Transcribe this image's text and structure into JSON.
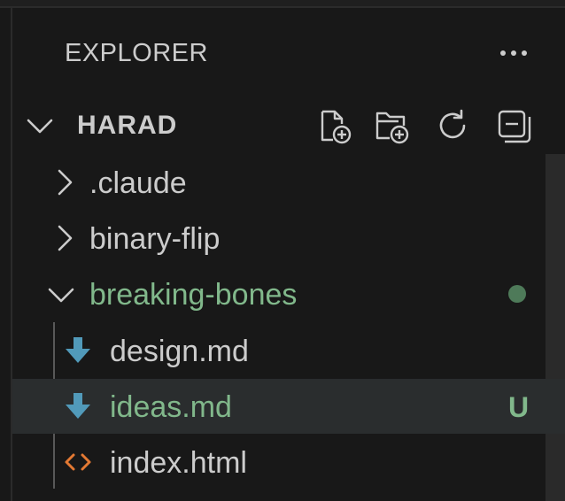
{
  "panel": {
    "title": "EXPLORER"
  },
  "workspace": {
    "name": "HARAD",
    "actions": [
      {
        "label": "New File...",
        "icon": "new-file-icon"
      },
      {
        "label": "New Folder...",
        "icon": "new-folder-icon"
      },
      {
        "label": "Refresh Explorer",
        "icon": "refresh-icon"
      },
      {
        "label": "Collapse Folders in Explorer",
        "icon": "collapse-all-icon"
      }
    ]
  },
  "tree": [
    {
      "label": ".claude",
      "type": "folder",
      "expanded": false
    },
    {
      "label": "binary-flip",
      "type": "folder",
      "expanded": false
    },
    {
      "label": "breaking-bones",
      "type": "folder",
      "expanded": true,
      "status": "modified-dot",
      "children": [
        {
          "label": "design.md",
          "type": "markdown-file"
        },
        {
          "label": "ideas.md",
          "type": "markdown-file",
          "status": "U",
          "selected": true
        },
        {
          "label": "index.html",
          "type": "html-file"
        }
      ]
    }
  ],
  "colors": {
    "background": "#181818",
    "text": "#cccccc",
    "git_untracked": "#81b88b",
    "markdown_icon": "#519aba",
    "html_icon": "#e37933",
    "selection": "#2a2d2e"
  }
}
